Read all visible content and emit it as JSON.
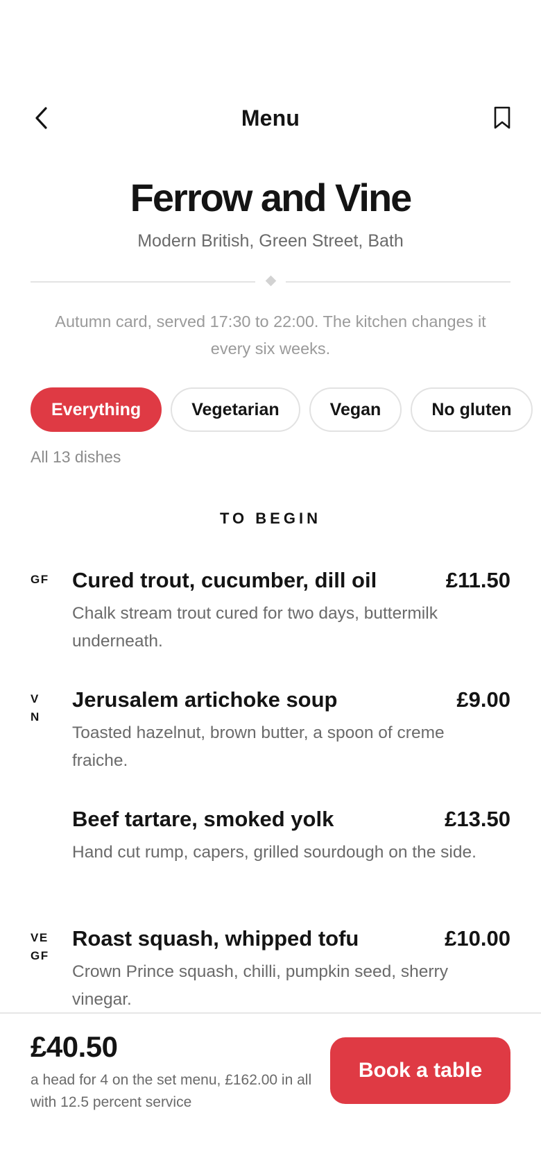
{
  "header": {
    "title": "Menu",
    "back_icon": "chevron-left-icon",
    "bookmark_icon": "bookmark-icon"
  },
  "restaurant": {
    "name": "Ferrow and Vine",
    "subtitle": "Modern British, Green Street, Bath",
    "card_note": "Autumn card, served 17:30 to 22:00. The kitchen changes it every six weeks."
  },
  "filters": {
    "chips": [
      {
        "label": "Everything",
        "active": true
      },
      {
        "label": "Vegetarian",
        "active": false
      },
      {
        "label": "Vegan",
        "active": false
      },
      {
        "label": "No gluten",
        "active": false
      }
    ],
    "count_text": "All 13 dishes"
  },
  "sections": [
    {
      "title": "TO BEGIN",
      "dishes": [
        {
          "tags": [
            "GF"
          ],
          "name": "Cured trout, cucumber, dill oil",
          "price": "£11.50",
          "description": "Chalk stream trout cured for two days, buttermilk underneath."
        },
        {
          "tags": [
            "V",
            "N"
          ],
          "name": "Jerusalem artichoke soup",
          "price": "£9.00",
          "description": "Toasted hazelnut, brown butter, a spoon of creme fraiche."
        },
        {
          "tags": [],
          "name": "Beef tartare, smoked yolk",
          "price": "£13.50",
          "description": "Hand cut rump, capers, grilled sourdough on the side."
        },
        {
          "tags": [
            "VE",
            "GF"
          ],
          "name": "Roast squash, whipped tofu",
          "price": "£10.00",
          "description": "Crown Prince squash, chilli, pumpkin seed, sherry vinegar."
        }
      ]
    }
  ],
  "footer": {
    "total": "£40.50",
    "total_note": "a head for 4 on the set menu, £162.00 in all with 12.5 percent service",
    "cta_label": "Book a table"
  },
  "colors": {
    "accent": "#df3a44",
    "text": "#141414",
    "muted": "#6a6a6a"
  }
}
